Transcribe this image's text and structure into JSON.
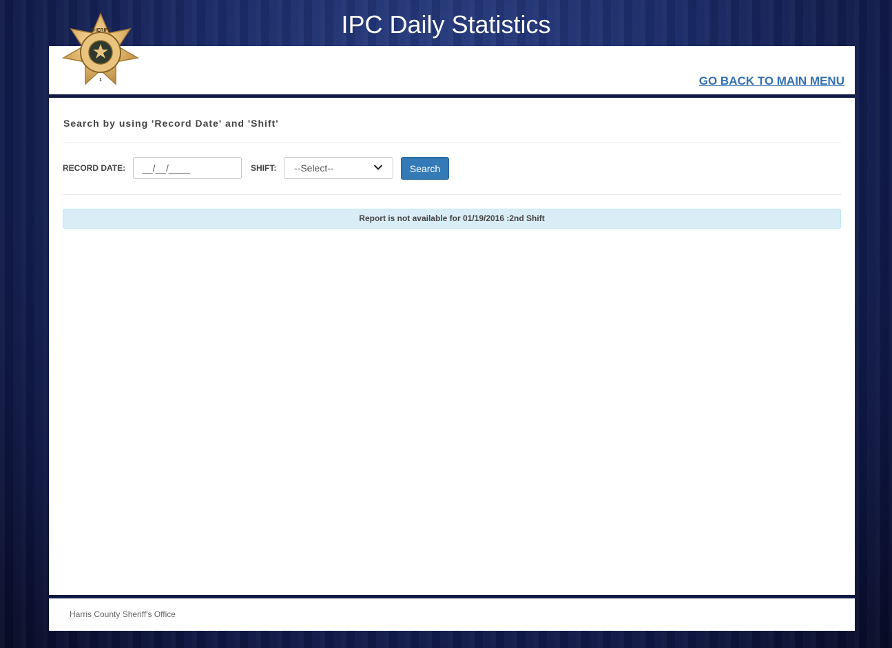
{
  "header": {
    "title": "IPC Daily Statistics",
    "back_link": "GO BACK TO MAIN MENU",
    "logo_icon": "sheriff-badge-icon",
    "logo_text": [
      "SHERIFF",
      "HARRIS COUNTY",
      "SHERIFF'S OFFICE",
      "1"
    ]
  },
  "search": {
    "heading": "Search by using 'Record Date' and 'Shift'",
    "record_date_label": "RECORD DATE:",
    "record_date_value": "__/__/____",
    "shift_label": "SHIFT:",
    "shift_selected": "--Select--",
    "search_button": "Search"
  },
  "alert": {
    "message": "Report is not available for 01/19/2016 :2nd Shift"
  },
  "footer": {
    "text": "Harris County Sheriff's Office"
  },
  "colors": {
    "accent": "#337ab7",
    "link": "#3371b3",
    "band": "#0f1a45",
    "alert_bg": "#d9edf7",
    "alert_border": "#bce8f1"
  }
}
